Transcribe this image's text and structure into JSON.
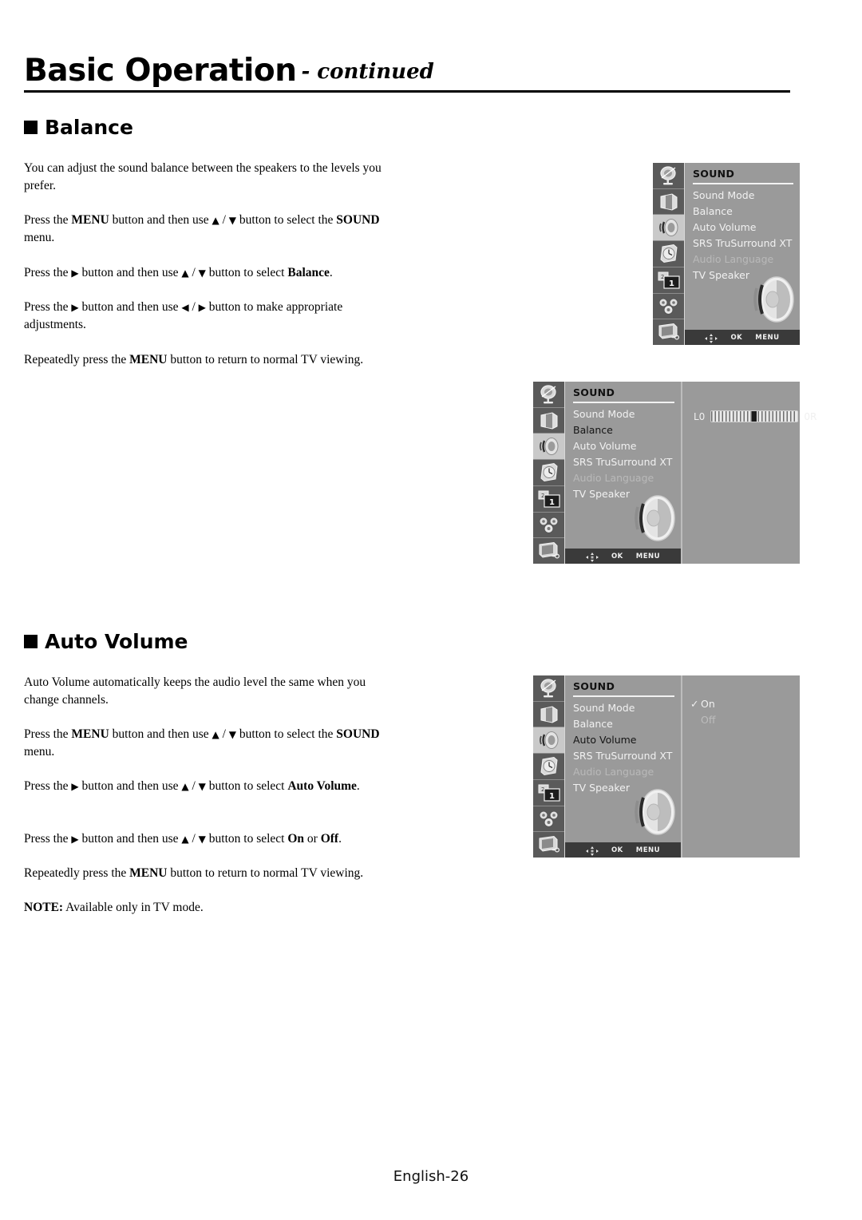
{
  "header": {
    "title": "Basic Operation",
    "continued": "- continued"
  },
  "sections": [
    {
      "heading": "Balance",
      "paragraphs": [
        "You can adjust the sound balance between the speakers to the levels you prefer.",
        "Press the MENU button and then use ▲ / ▼ button to select the SOUND menu.",
        "Press the ▶ button and then use ▲ / ▼ button to select Balance.",
        "Press the ▶ button and then use ◀ / ▶ button to make appropriate adjustments.",
        "Repeatedly press the MENU button to return to normal TV viewing."
      ]
    },
    {
      "heading": "Auto Volume",
      "paragraphs": [
        "Auto Volume automatically keeps the audio level the same when you change channels.",
        "Press the MENU button and then use ▲ / ▼ button to select the SOUND menu.",
        "Press the ▶ button and then use ▲ / ▼ button to select Auto Volume.",
        "Press the ▶ button and then use ▲ / ▼ button to select On or Off.",
        "Repeatedly press the MENU button to return to normal TV viewing.",
        "NOTE: Available only in TV mode."
      ]
    }
  ],
  "osd": {
    "title": "SOUND",
    "sidebar_icons": [
      "satellite-dish-icon",
      "picture-screen-icon",
      "speaker-sound-icon",
      "clock-time-icon",
      "pip-screens-icon",
      "gears-setup-icon",
      "tv-input-icon"
    ],
    "selected_icon_index": 2,
    "menu_items": [
      "Sound Mode",
      "Balance",
      "Auto Volume",
      "SRS TruSurround XT",
      "Audio Language",
      "TV Speaker"
    ],
    "dimmed_item": "Audio Language",
    "bottom_bar": {
      "nav_icon": "dpad-navigate-icon",
      "ok_label": "OK",
      "menu_label": "MENU"
    },
    "screens": [
      {
        "name": "sound-menu-overview",
        "highlighted_item": null,
        "pane": "none"
      },
      {
        "name": "balance-adjust",
        "highlighted_item": "Balance",
        "pane": "slider",
        "slider": {
          "left_label": "L0",
          "right_label": "0R",
          "value": 0,
          "min": -50,
          "max": 50
        }
      },
      {
        "name": "auto-volume-options",
        "highlighted_item": "Auto Volume",
        "pane": "options",
        "options": [
          {
            "label": "On",
            "checked": true
          },
          {
            "label": "Off",
            "checked": false
          }
        ],
        "check_glyph": "✓"
      }
    ]
  },
  "footer": {
    "page_label": "English-26"
  },
  "colors": {
    "osd_background": "#9a9a9a",
    "osd_sidebar": "#5a5a5a",
    "osd_sidebar_selected": "#c9c9c9",
    "osd_bottom_bar": "#3a3a3a",
    "osd_text": "#f1f1f1",
    "osd_text_dim": "#b9b9b9",
    "osd_text_active": "#151515",
    "page_text": "#000000"
  }
}
